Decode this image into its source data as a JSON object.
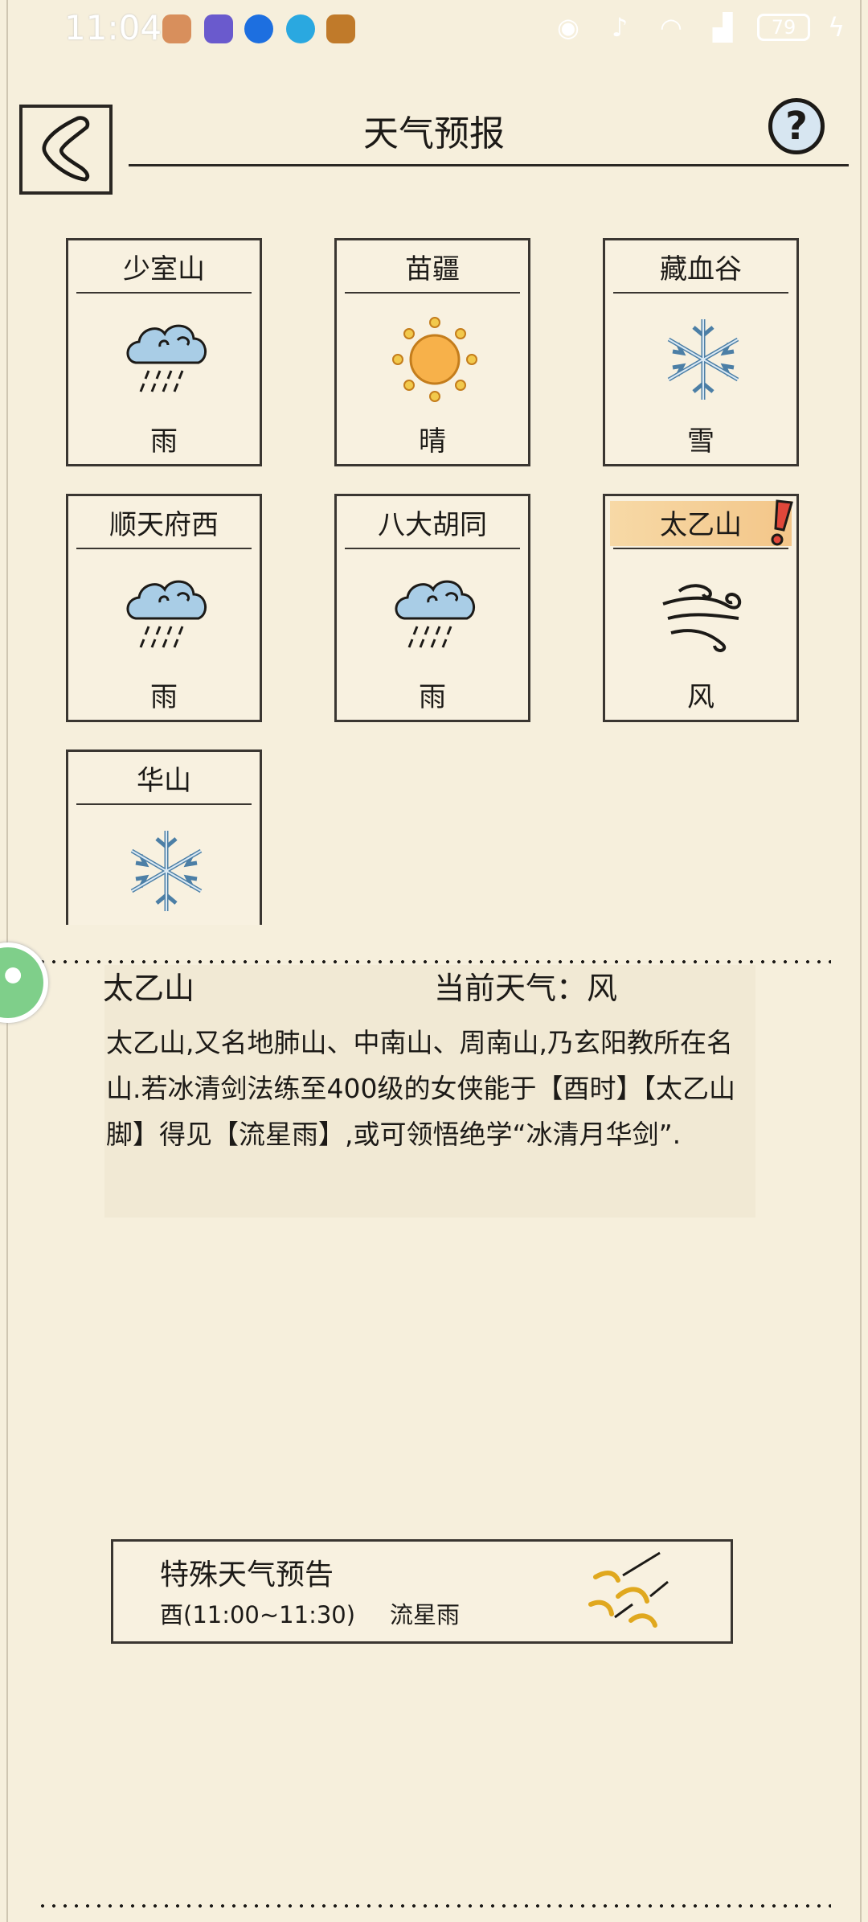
{
  "status_bar": {
    "time": "11:04",
    "battery": "79",
    "icons": [
      "eye-icon",
      "mute-icon",
      "wifi-icon",
      "signal-icon",
      "battery-icon",
      "charging-icon"
    ]
  },
  "header": {
    "title": "天气预报",
    "help_label": "?"
  },
  "cards": [
    {
      "name": "少室山",
      "weather": "雨",
      "icon": "rain-icon"
    },
    {
      "name": "苗疆",
      "weather": "晴",
      "icon": "sun-icon"
    },
    {
      "name": "藏血谷",
      "weather": "雪",
      "icon": "snow-icon"
    },
    {
      "name": "顺天府西",
      "weather": "雨",
      "icon": "rain-icon"
    },
    {
      "name": "八大胡同",
      "weather": "雨",
      "icon": "rain-icon"
    },
    {
      "name": "太乙山",
      "weather": "风",
      "icon": "wind-icon",
      "active": true
    },
    {
      "name": "华山",
      "weather": "",
      "icon": "snow-icon"
    }
  ],
  "info": {
    "location": "太乙山",
    "current_weather": "当前天气：风",
    "description": "太乙山,又名地肺山、中南山、周南山,乃玄阳教所在名山.若冰清剑法练至400级的女侠能于【酉时】【太乙山脚】得见【流星雨】,或可领悟绝学“冰清月华剑”."
  },
  "special": {
    "title": "特殊天气预告",
    "time": "酉(11:00~11:30)",
    "event": "流星雨"
  },
  "colors": {
    "background": "#f6efdc",
    "active_tab": "#f3c689",
    "badge_green": "#7fcf8a",
    "icon_blue": "#a9cde6"
  }
}
